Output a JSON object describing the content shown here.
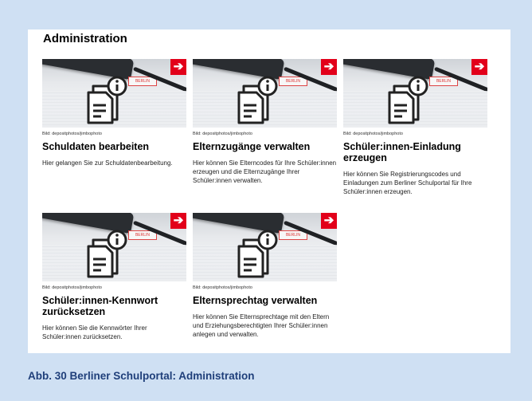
{
  "section_title": "Administration",
  "cards": [
    {
      "credit": "Bild: depositphotos/jimbophoto",
      "title": "Schuldaten bearbeiten",
      "desc": "Hier gelangen Sie zur Schuldatenbearbeitung.",
      "stamp": "BERLIN",
      "arrow": "➔"
    },
    {
      "credit": "Bild: depositphotos/jimbophoto",
      "title": "Elternzugänge verwalten",
      "desc": "Hier können Sie Elterncodes für Ihre Schüler:innen erzeugen und die Elternzugänge Ihrer Schüler:innen verwalten.",
      "stamp": "BERLIN",
      "arrow": "➔"
    },
    {
      "credit": "Bild: depositphotos/jimbophoto",
      "title": "Schüler:innen-Einladung erzeugen",
      "desc": "Hier können Sie Registrierungscodes und Einladungen zum Berliner Schulportal für Ihre Schüler:innen erzeugen.",
      "stamp": "BERLIN",
      "arrow": "➔"
    },
    {
      "credit": "Bild: depositphotos/jimbophoto",
      "title": "Schüler:innen-Kennwort zurücksetzen",
      "desc": "Hier können Sie die Kennwörter Ihrer Schüler:innen zurücksetzen.",
      "stamp": "BERLIN",
      "arrow": "➔"
    },
    {
      "credit": "Bild: depositphotos/jimbophoto",
      "title": "Elternsprechtag verwalten",
      "desc": "Hier können Sie Elternsprechtage mit den Eltern und Erziehungsberechtigten Ihrer Schüler:innen anlegen und verwalten.",
      "stamp": "BERLIN",
      "arrow": "➔"
    }
  ],
  "caption": "Abb. 30  Berliner Schulportal: Administration",
  "colors": {
    "background": "#cfe0f3",
    "accent": "#e2001a",
    "caption": "#1f3f7a"
  },
  "icons": {
    "card_icon": "document-info-icon",
    "arrow_icon": "arrow-right-icon"
  }
}
